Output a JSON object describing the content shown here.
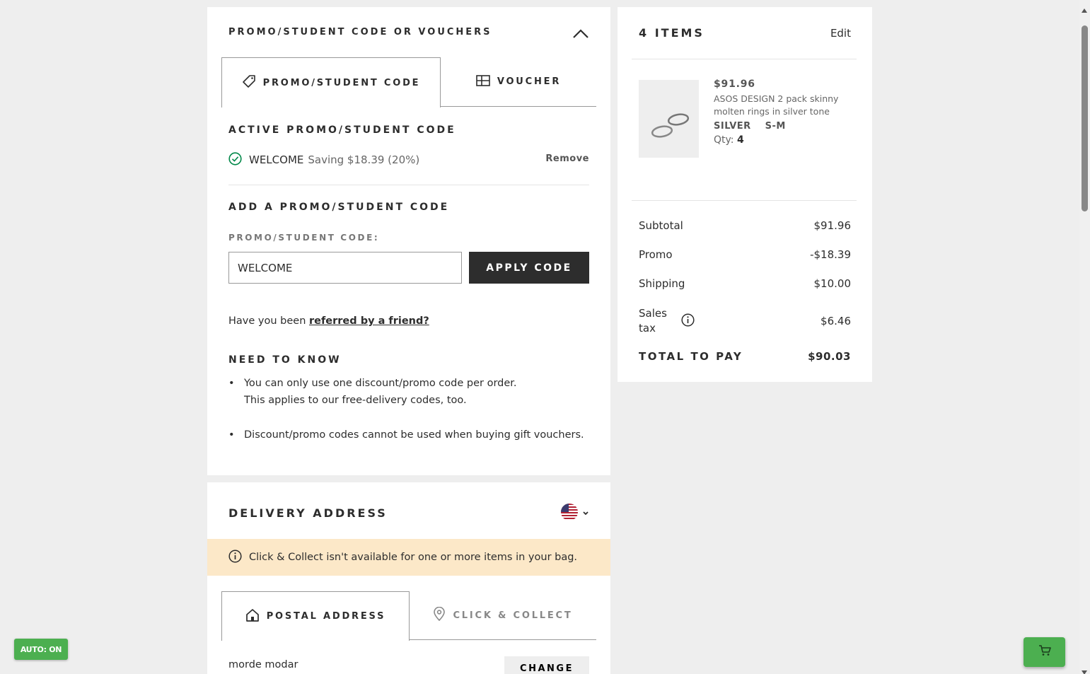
{
  "promo": {
    "section_title": "PROMO/STUDENT CODE OR VOUCHERS",
    "tabs": [
      {
        "label": "PROMO/STUDENT CODE",
        "icon": "tag-icon",
        "active": true
      },
      {
        "label": "VOUCHER",
        "icon": "voucher-icon",
        "active": false
      }
    ],
    "active_heading": "ACTIVE PROMO/STUDENT CODE",
    "active_code": "WELCOME",
    "active_saving": "Saving $18.39 (20%)",
    "remove_label": "Remove",
    "add_heading": "ADD A PROMO/STUDENT CODE",
    "field_label": "PROMO/STUDENT CODE:",
    "input_value": "WELCOME",
    "apply_label": "APPLY CODE",
    "referral_text": "Have you been",
    "referral_link": "referred by a friend?",
    "need_to_know_heading": "NEED TO KNOW",
    "bullets": [
      {
        "line1": "You can only use one discount/promo code per order.",
        "line2": "This applies to our free-delivery codes, too."
      },
      {
        "line1": "Discount/promo codes cannot be used when buying gift vouchers.",
        "line2": ""
      }
    ]
  },
  "delivery": {
    "title": "DELIVERY ADDRESS",
    "country_icon": "us-flag-icon",
    "notice": "Click & Collect isn't available for one or more items in your bag.",
    "tabs": [
      {
        "label": "POSTAL ADDRESS",
        "icon": "home-icon",
        "active": true
      },
      {
        "label": "CLICK & COLLECT",
        "icon": "location-pin-icon",
        "active": false
      }
    ],
    "address_name": "morde modar",
    "change_label": "CHANGE"
  },
  "summary": {
    "items_title": "4 ITEMS",
    "edit_label": "Edit",
    "item": {
      "price": "$91.96",
      "name": "ASOS DESIGN 2 pack skinny molten rings in silver tone",
      "color": "SILVER",
      "size": "S-M",
      "qty_label": "Qty:",
      "qty": "4"
    },
    "rows": [
      {
        "label": "Subtotal",
        "value": "$91.96"
      },
      {
        "label": "Promo",
        "value": "-$18.39"
      },
      {
        "label": "Shipping",
        "value": "$10.00"
      },
      {
        "label": "Sales tax",
        "value": "$6.46"
      }
    ],
    "total_label": "TOTAL TO PAY",
    "total_value": "$90.03"
  },
  "overlay": {
    "auto_badge": "AUTO: ON",
    "cart_icon": "cart-icon"
  },
  "colors": {
    "dark": "#2d2d2d",
    "notice_bg": "#fce8c8",
    "success_green": "#018849",
    "extension_green": "#4caf50"
  }
}
